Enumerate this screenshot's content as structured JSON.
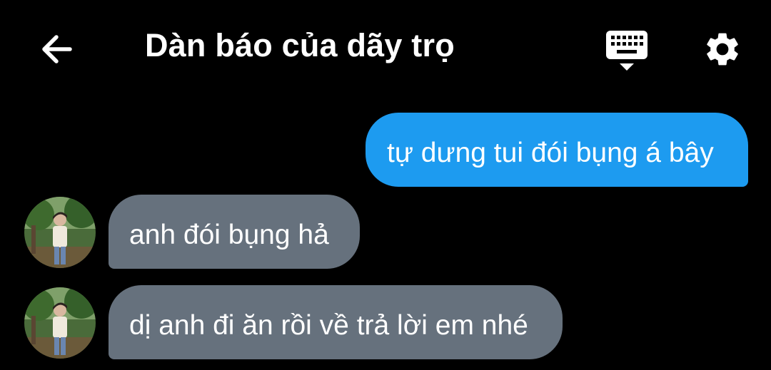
{
  "header": {
    "title": "Dàn báo của dãy trọ",
    "back_icon": "arrow-left-icon",
    "keyboard_icon": "keyboard-icon",
    "settings_icon": "gear-icon"
  },
  "messages": [
    {
      "direction": "sent",
      "text": "tự dưng tui đói bụng á bây"
    },
    {
      "direction": "received",
      "text": "anh đói bụng hả"
    },
    {
      "direction": "received",
      "text": "dị anh đi ăn rồi về trả lời em nhé"
    }
  ],
  "colors": {
    "background": "#000000",
    "sent_bubble": "#1d9bf0",
    "received_bubble": "#66717d",
    "text": "#ffffff"
  }
}
